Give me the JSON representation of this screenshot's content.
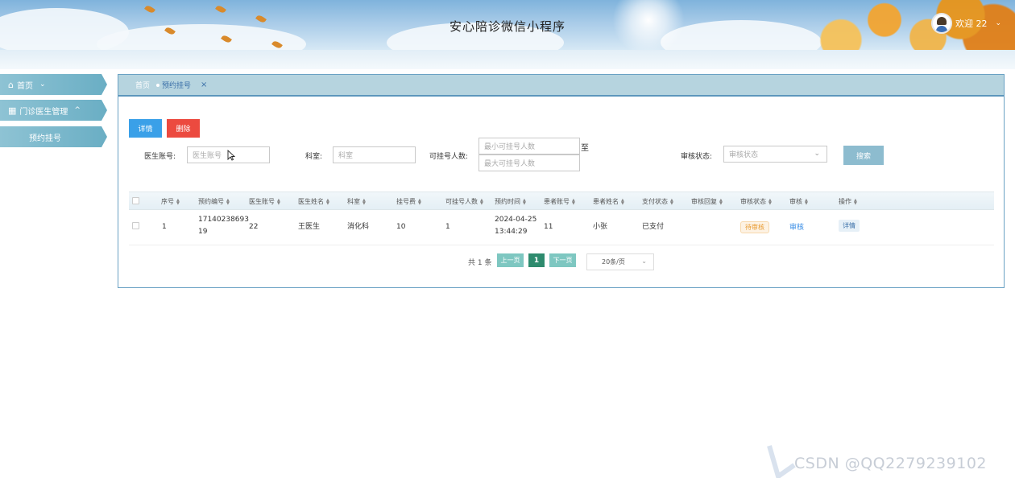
{
  "header": {
    "title": "安心陪诊微信小程序",
    "welcome": "欢迎 22",
    "caret": "⌄"
  },
  "sidebar": {
    "items": [
      {
        "icon": "⌂",
        "label": "首页",
        "caret": "⌄"
      },
      {
        "icon": "▦",
        "label": "门诊医生管理",
        "caret": "^"
      },
      {
        "label": "预约挂号"
      }
    ]
  },
  "tabs": {
    "home": "首页",
    "active": "预约挂号",
    "close": "×"
  },
  "toolbar": {
    "detail": "详情",
    "delete": "删除"
  },
  "filters": {
    "doctor_account_label": "医生账号:",
    "doctor_account_placeholder": "医生账号",
    "department_label": "科室:",
    "department_placeholder": "科室",
    "capacity_label": "可挂号人数:",
    "capacity_min_placeholder": "最小可挂号人数",
    "capacity_max_placeholder": "最大可挂号人数",
    "to": "至",
    "audit_label": "审核状态:",
    "audit_placeholder": "审核状态",
    "search": "搜索"
  },
  "table": {
    "columns": [
      "序号",
      "预约编号",
      "医生账号",
      "医生姓名",
      "科室",
      "挂号费",
      "可挂号人数",
      "预约时间",
      "患者账号",
      "患者姓名",
      "支付状态",
      "审核回复",
      "审核状态",
      "审核",
      "操作"
    ],
    "rows": [
      {
        "index": "1",
        "booking_no_line1": "17140238693",
        "booking_no_line2": "19",
        "doctor_account": "22",
        "doctor_name": "王医生",
        "department": "消化科",
        "fee": "10",
        "capacity": "1",
        "time_line1": "2024-04-25",
        "time_line2": "13:44:29",
        "patient_account": "11",
        "patient_name": "小张",
        "pay_status": "已支付",
        "audit_reply": "",
        "audit_status": "待审核",
        "audit_action": "审核",
        "operation": "详情"
      }
    ]
  },
  "pagination": {
    "total": "共 1 条",
    "prev": "上一页",
    "current": "1",
    "next": "下一页",
    "page_size": "20条/页"
  },
  "watermark": "CSDN @QQ2279239102"
}
